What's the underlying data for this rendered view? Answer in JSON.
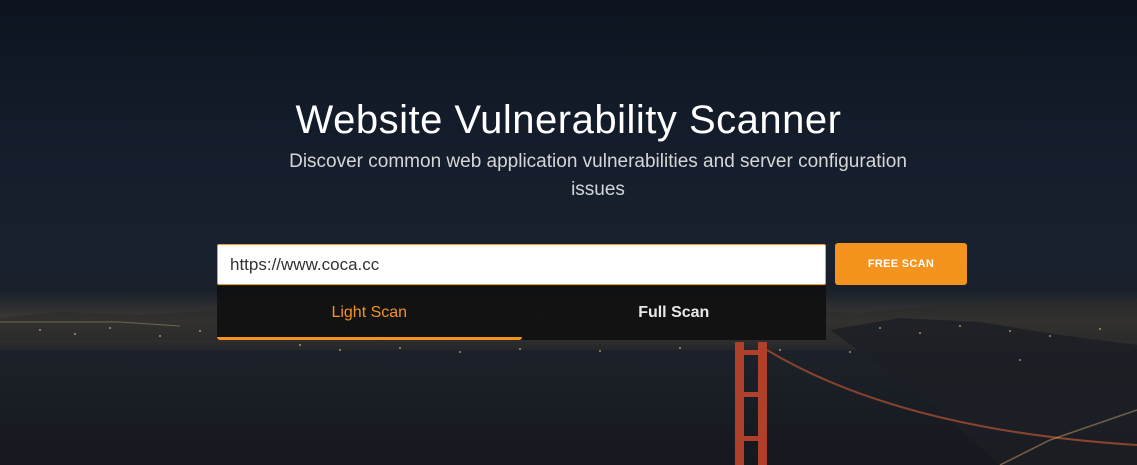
{
  "hero": {
    "title": "Website Vulnerability Scanner",
    "subtitle": "Discover common web application vulnerabilities and server configuration issues"
  },
  "scan_form": {
    "url_value": "https://www.coca.cc",
    "submit_label": "FREE SCAN"
  },
  "scan_types": [
    {
      "label": "Light Scan",
      "active": true
    },
    {
      "label": "Full Scan",
      "active": false
    }
  ],
  "colors": {
    "accent": "#f5931f",
    "background": "#141d2b",
    "title_text": "#ffffff"
  },
  "icons": {
    "background": "city-night-bridge-image"
  }
}
